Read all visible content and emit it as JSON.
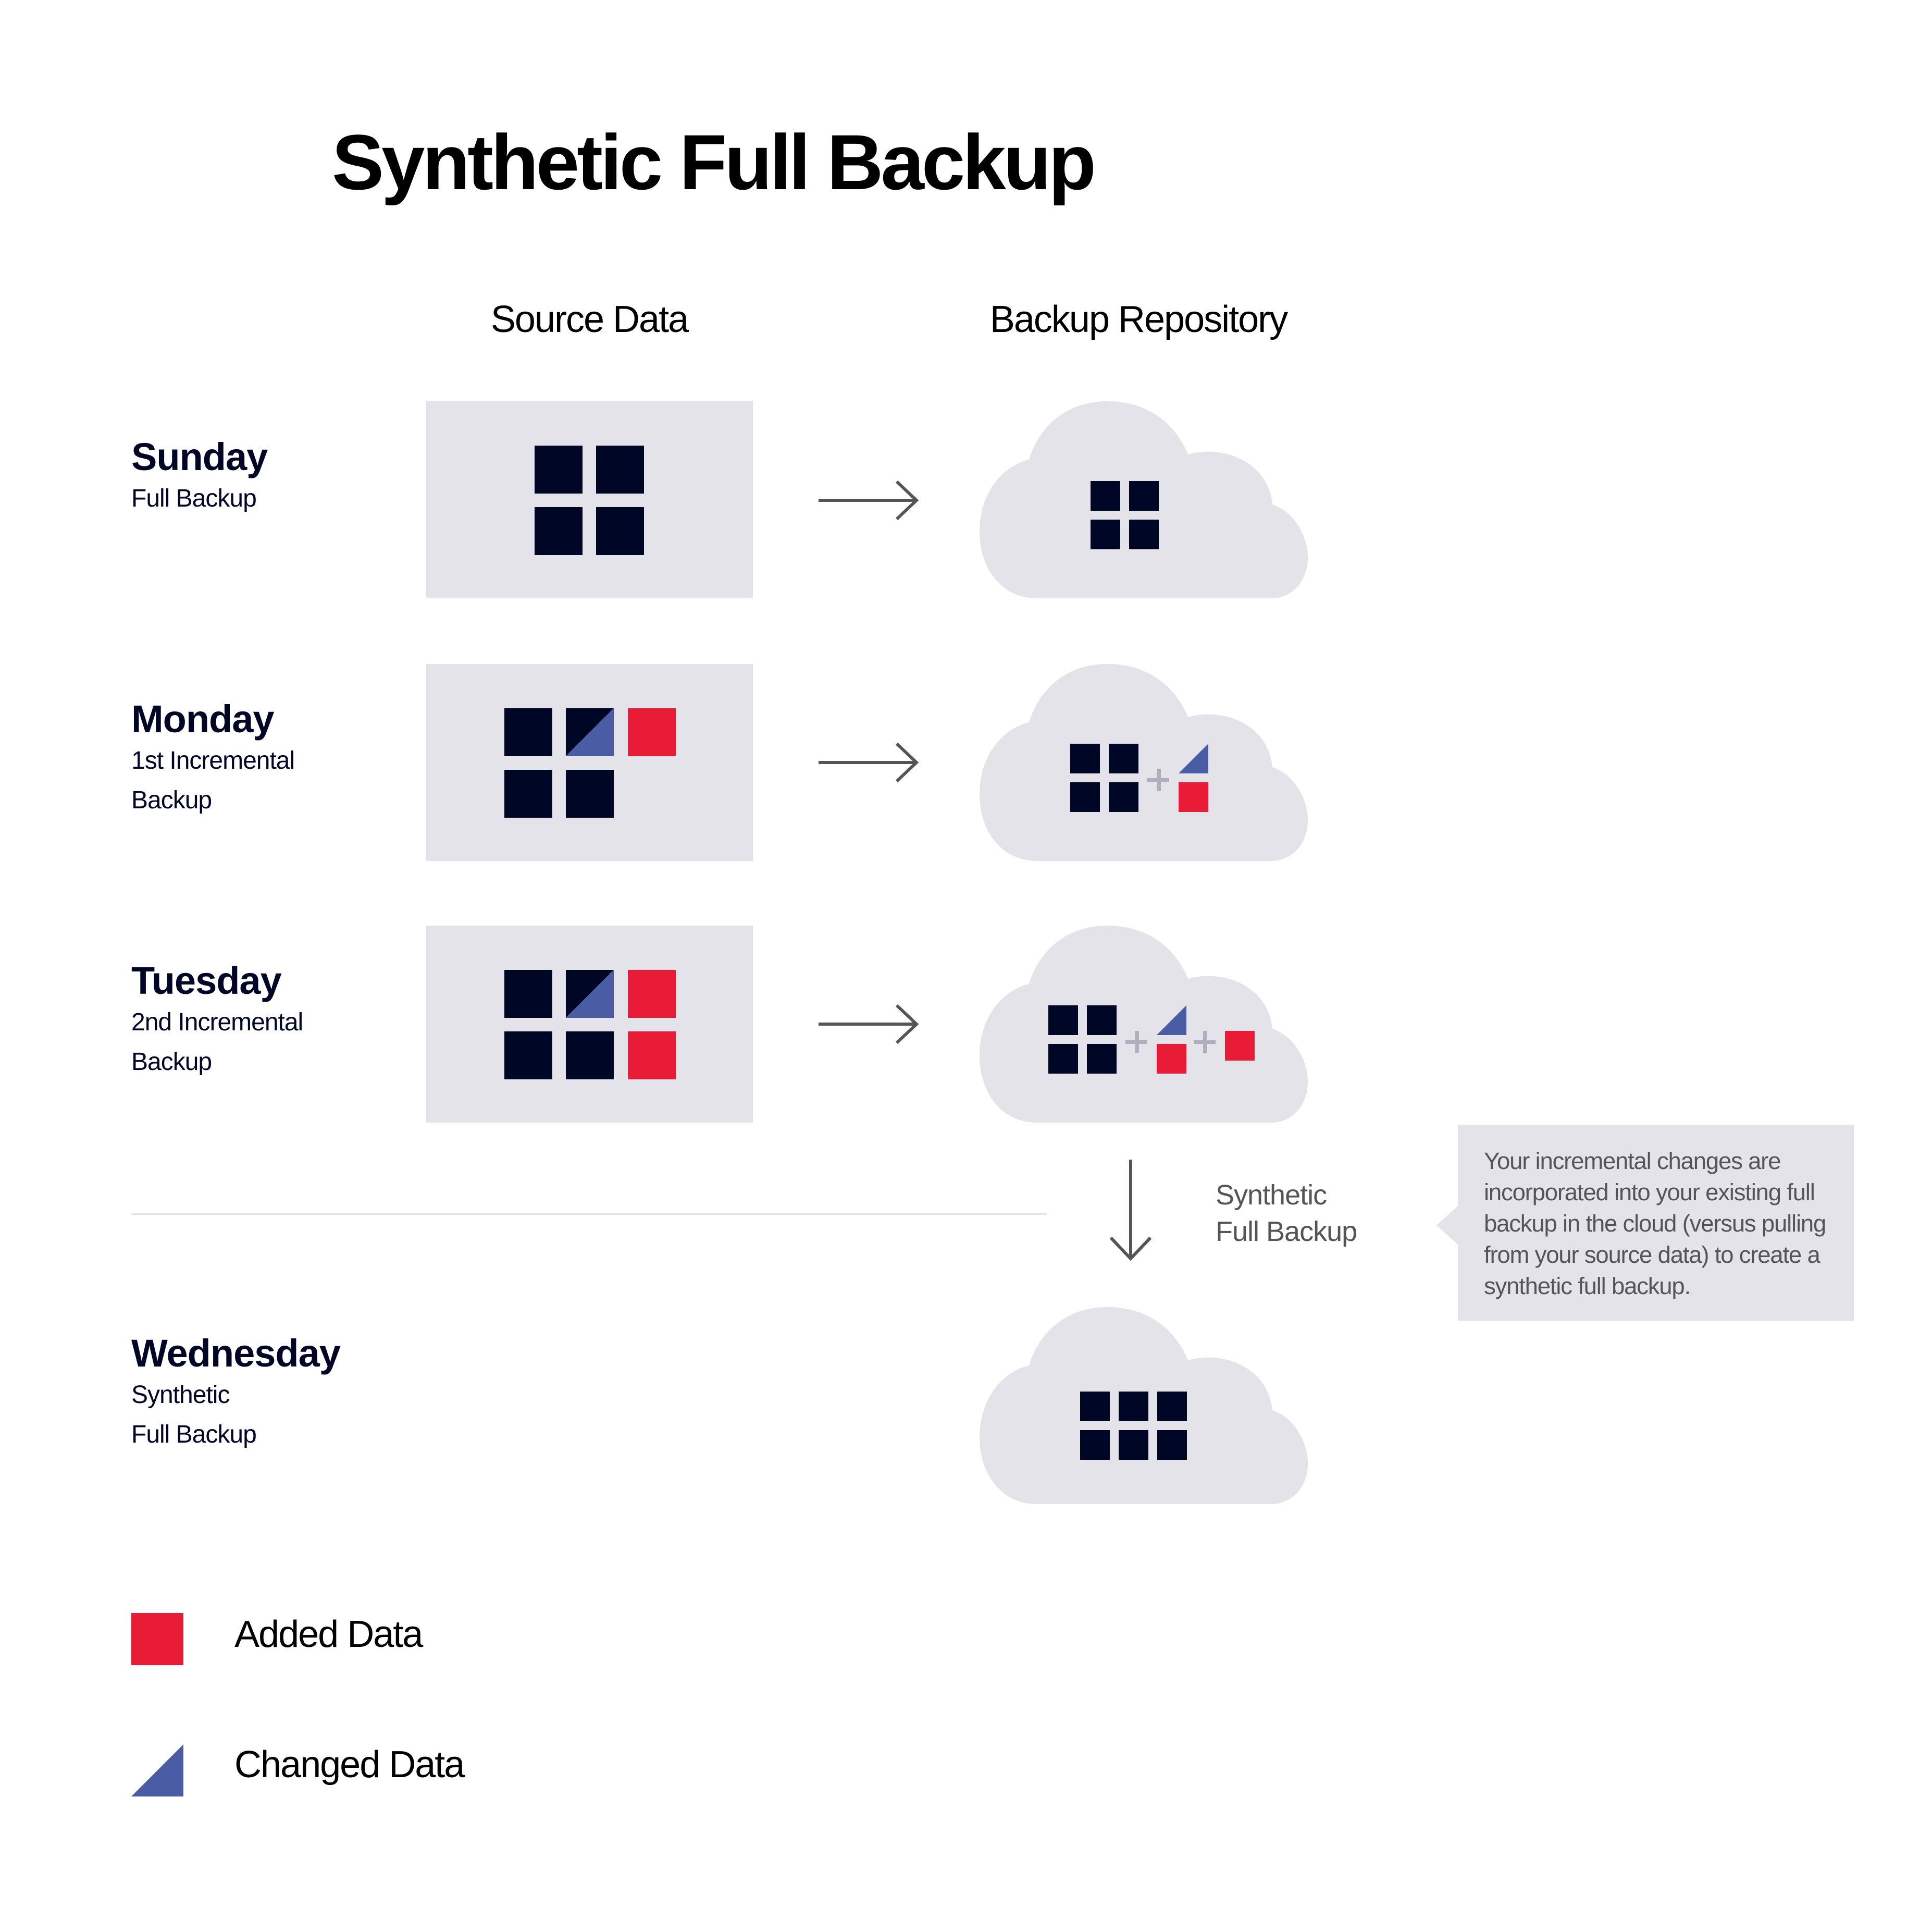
{
  "title": "Synthetic Full Backup",
  "columns": {
    "source": "Source Data",
    "repository": "Backup Repository"
  },
  "rows": [
    {
      "day": "Sunday",
      "subtitle_lines": [
        "Full Backup"
      ],
      "source_blocks": {
        "base": 4,
        "changed": 0,
        "added": 0
      },
      "cloud_blocks": "4 base blocks"
    },
    {
      "day": "Monday",
      "subtitle_lines": [
        "1st Incremental",
        "Backup"
      ],
      "source_blocks": {
        "base": 4,
        "changed": 1,
        "added": 1
      },
      "cloud_blocks": "4 base blocks + 1 changed + 1 added"
    },
    {
      "day": "Tuesday",
      "subtitle_lines": [
        "2nd Incremental",
        "Backup"
      ],
      "source_blocks": {
        "base": 4,
        "changed": 1,
        "added": 2
      },
      "cloud_blocks": "4 base blocks + (1 changed, 1 added) + 1 added"
    },
    {
      "day": "Wednesday",
      "subtitle_lines": [
        "Synthetic",
        "Full Backup"
      ],
      "cloud_blocks": "6 blocks merged"
    }
  ],
  "synthetic_label_lines": [
    "Synthetic",
    "Full Backup"
  ],
  "callout": "Your incremental changes are incorporated into your existing full backup in the cloud (versus pulling from your source data) to create a synthetic full backup.",
  "legend": [
    {
      "label": "Added Data",
      "icon": "red-square-icon",
      "color": "#e81c36"
    },
    {
      "label": "Changed Data",
      "icon": "blue-triangle-icon",
      "color": "#4a5ca3"
    }
  ],
  "colors": {
    "base_block": "#000626",
    "added": "#e81c36",
    "changed": "#4a5ca3",
    "panel": "#e4e3ea",
    "arrow": "#555559"
  }
}
